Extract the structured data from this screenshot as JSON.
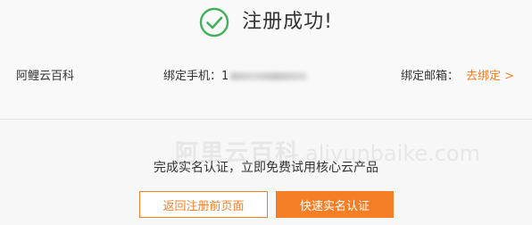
{
  "success": {
    "title": "注册成功!",
    "icon": "check-circle-icon",
    "icon_color": "#43b05c"
  },
  "account": {
    "brand": "阿鲤云百科",
    "phone_label": "绑定手机：",
    "phone_visible_prefix": "1",
    "email_label": "绑定邮箱：",
    "email_link": "去绑定 >"
  },
  "watermark": {
    "text": "阿里云百科",
    "domain": "aliyunbaike.com"
  },
  "promo": {
    "text": "完成实名认证，立即免费试用核心云产品"
  },
  "buttons": {
    "back_label": "返回注册前页面",
    "verify_label": "快速实名认证"
  },
  "colors": {
    "accent": "#f57f26",
    "background": "#f7f7f7"
  }
}
